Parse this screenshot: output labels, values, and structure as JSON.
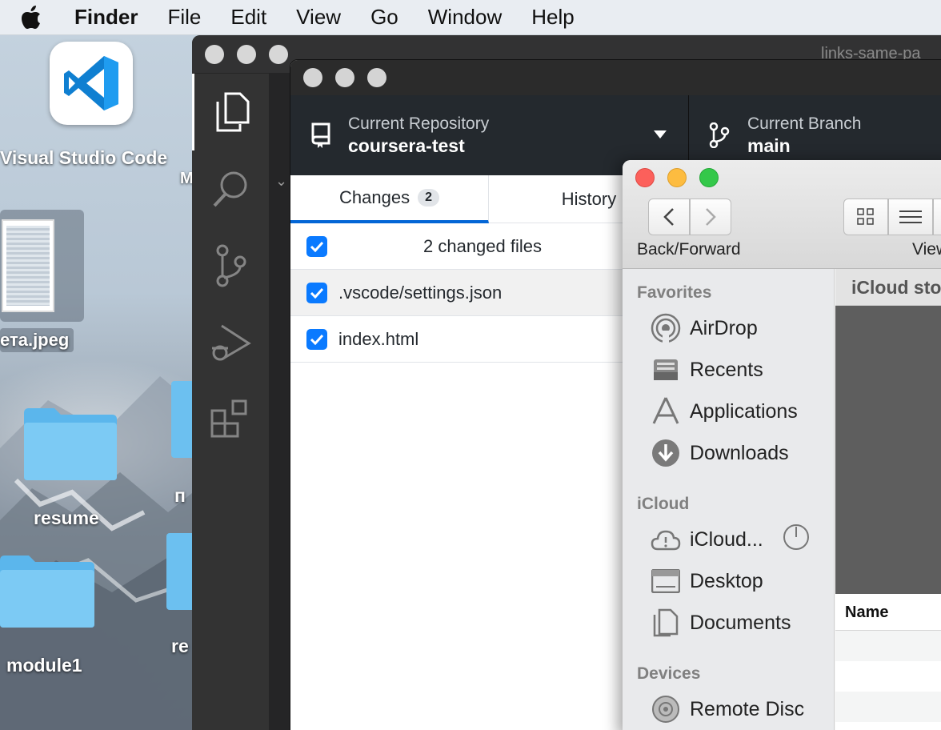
{
  "menubar": {
    "app_name": "Finder",
    "items": [
      "File",
      "Edit",
      "View",
      "Go",
      "Window",
      "Help"
    ]
  },
  "desktop": {
    "vscode_label": "Visual Studio Code",
    "partial_m": "M",
    "image_label": "ета.jpeg",
    "folders": [
      {
        "label": "resume"
      },
      {
        "label": "module1"
      }
    ],
    "partial_labels": [
      "п",
      "re"
    ]
  },
  "vscode": {
    "title_partial": "links-same-pa"
  },
  "github": {
    "repo_sub": "Current Repository",
    "repo_name": "coursera-test",
    "branch_sub": "Current Branch",
    "branch_name": "main",
    "tabs": {
      "changes": "Changes",
      "changes_count": "2",
      "history": "History"
    },
    "summary": "2 changed files",
    "files": [
      ".vscode/settings.json",
      "index.html"
    ]
  },
  "finder": {
    "back_forward": "Back/Forward",
    "view_partial": "View",
    "path_partial": "iCloud sto",
    "name_header": "Name",
    "sections": {
      "favorites": "Favorites",
      "icloud": "iCloud",
      "devices": "Devices"
    },
    "favorites": [
      "AirDrop",
      "Recents",
      "Applications",
      "Downloads"
    ],
    "icloud_items": [
      "iCloud...",
      "Desktop",
      "Documents"
    ],
    "devices": [
      "Remote Disc"
    ]
  }
}
